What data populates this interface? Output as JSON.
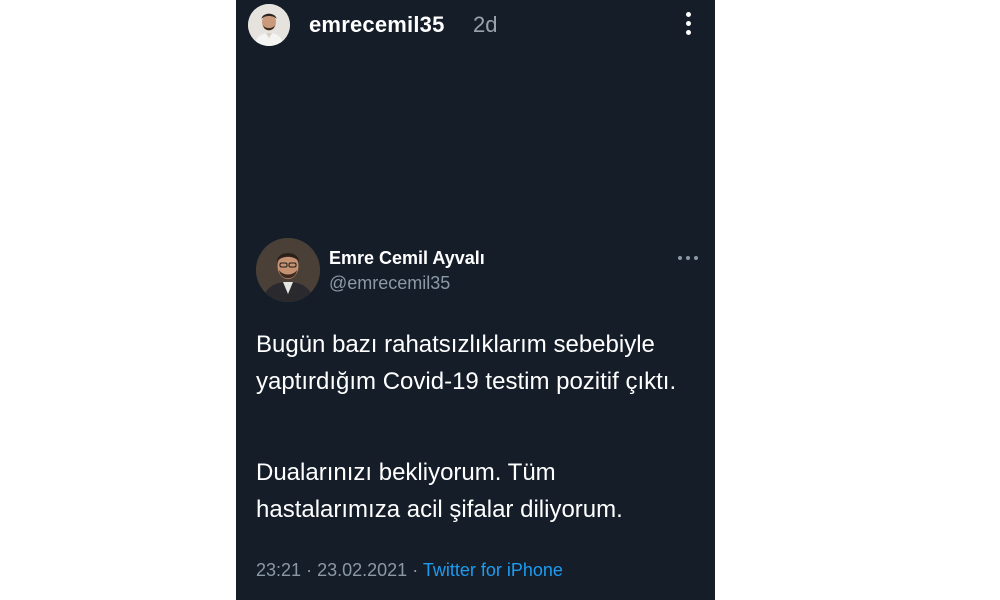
{
  "story": {
    "username": "emrecemil35",
    "time_ago": "2d",
    "more_icon": "vertical-ellipsis-icon"
  },
  "tweet": {
    "display_name": "Emre Cemil Ayvalı",
    "handle": "@emrecemil35",
    "more_icon": "horizontal-ellipsis-icon",
    "paragraphs": [
      "Bugün bazı rahatsızlıklarım sebebiyle yaptırdığım Covid-19 testim pozitif çıktı.",
      "Dualarınızı bekliyorum. Tüm hastalarımıza acil şifalar diliyorum."
    ],
    "time": "23:21",
    "separator": "·",
    "date": "23.02.2021",
    "source": "Twitter for iPhone"
  },
  "colors": {
    "background": "#151d29",
    "text": "#ffffff",
    "secondary_text": "#8b98a5",
    "link": "#1d9bf0"
  }
}
